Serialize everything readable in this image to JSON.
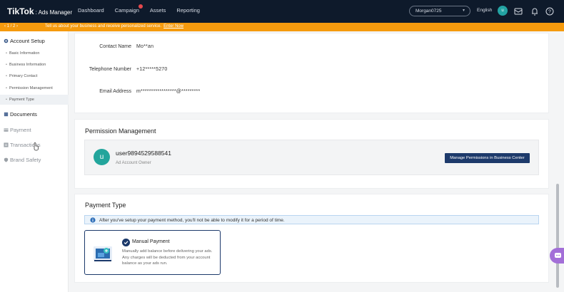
{
  "topbar": {
    "logo": "TikTok",
    "logo_sub": ": Ads Manager",
    "nav": [
      "Dashboard",
      "Campaign",
      "Assets",
      "Reporting"
    ],
    "account": "Morgan0725",
    "language": "English",
    "avatar_initial": "u"
  },
  "notice": {
    "page": "‹ 1 / 2 ›",
    "message": "Tell us about your business and receive personalized service.",
    "link": "Enter Now"
  },
  "sidebar": {
    "account_setup": "Account Setup",
    "sub_items": [
      "Basic Information",
      "Business Information",
      "Primary Contact",
      "Permission Management",
      "Payment Type"
    ],
    "documents": "Documents",
    "payment": "Payment",
    "transactions": "Transactions",
    "brand_safety": "Brand Safety"
  },
  "contact": {
    "name_label": "Contact Name",
    "name_value": "Mo**an",
    "phone_label": "Telephone Number",
    "phone_value": "+12*****5270",
    "email_label": "Email Address",
    "email_value": "m*****************@*********"
  },
  "permission": {
    "title": "Permission Management",
    "user_initial": "u",
    "user_name": "user9894529588541",
    "user_role": "Ad Account Owner",
    "button": "Manage Permissions in Business Center"
  },
  "payment_type": {
    "title": "Payment Type",
    "info": "After you've setup your payment method, you'll not be able to modify it for a period of time.",
    "option_title": "Manual Payment",
    "option_desc": "Manually add balance before delivering your ads. Any charges will be deducted from your account balance as your ads run."
  },
  "icons": [
    "ticket-icon",
    "building-icon",
    "card-icon",
    "transactions-icon",
    "shield-icon",
    "mail-icon",
    "bell-icon",
    "help-icon",
    "info-icon",
    "check-icon",
    "chat-icon"
  ]
}
